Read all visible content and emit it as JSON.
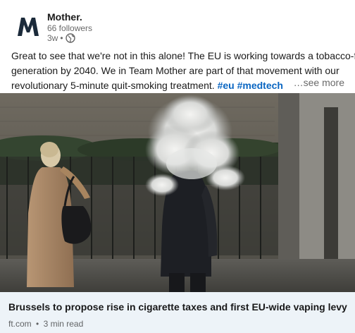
{
  "post": {
    "company": {
      "name": "Mother.",
      "logo_letter": "M",
      "followers": "66 followers",
      "time": "3w",
      "separator": "•",
      "visibility_icon": "globe-icon"
    },
    "text": {
      "line1": "Great to see that we're not in this alone! The EU is working towards a tobacco-free",
      "line2": "generation by 2040. We in Team Mother are part of that movement with our",
      "line3": "revolutionary 5-minute quit-smoking treatment.",
      "hashtag1": "#eu",
      "hashtag2": "#medtech",
      "see_more": "…see more"
    },
    "article": {
      "title": "Brussels to propose rise in cigarette taxes and first EU-wide vaping levy",
      "source": "ft.com",
      "separator": "•",
      "read_time": "3 min read"
    }
  },
  "colors": {
    "link": "#0a66c2",
    "article_bg": "#edf3f8",
    "logo": "#1b2a3a"
  }
}
